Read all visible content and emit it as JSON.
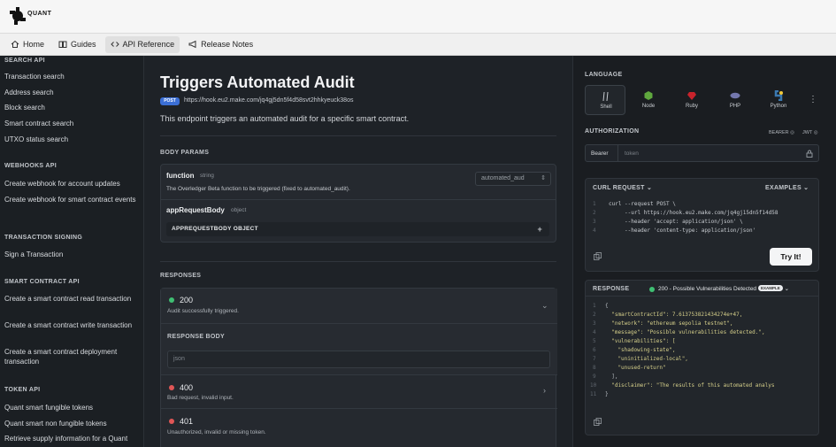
{
  "brand": {
    "name": "QUANT"
  },
  "nav": {
    "tabs": [
      {
        "label": "Home",
        "icon": "home-icon"
      },
      {
        "label": "Guides",
        "icon": "book-icon"
      },
      {
        "label": "API Reference",
        "icon": "code-icon",
        "active": true
      },
      {
        "label": "Release Notes",
        "icon": "megaphone-icon"
      }
    ]
  },
  "sidebar": {
    "search_head": "SEARCH API",
    "search_items": [
      "Transaction search",
      "Address search",
      "Block search",
      "Smart contract search",
      "UTXO status search"
    ],
    "webhooks_head": "WEBHOOKS API",
    "webhooks_items": [
      "Create webhook for account updates",
      "Create webhook for smart contract events"
    ],
    "signing_head": "TRANSACTION SIGNING",
    "signing_items": [
      "Sign a Transaction"
    ],
    "contract_head": "SMART CONTRACT API",
    "contract_items": [
      "Create a smart contract read transaction",
      "Create a smart contract write transaction",
      "Create a smart contract deployment transaction"
    ],
    "token_head": "TOKEN API",
    "token_items": [
      "Quant smart fungible tokens",
      "Quant smart non fungible tokens",
      "Retrieve supply information for a Quant"
    ]
  },
  "main": {
    "title": "Triggers Automated Audit",
    "method": "POST",
    "url": "https://hook.eu2.make.com/jq4gj5dn5f4d58svt2hhkyeuck38os",
    "description": "This endpoint triggers an automated audit for a specific smart contract.",
    "body_params_label": "BODY PARAMS",
    "param1": {
      "name": "function",
      "type": "string",
      "description": "The Overledger Beta function to be triggered (fixed to automated_audit).",
      "value": "automated_aud"
    },
    "param2": {
      "name": "appRequestBody",
      "type": "object",
      "button": "APPREQUESTBODY OBJECT"
    },
    "responses_label": "RESPONSES",
    "responses": [
      {
        "code": "200",
        "desc": "Audit successfully triggered.",
        "color": "#3fbf73"
      },
      {
        "code": "400",
        "desc": "Bad request, invalid input.",
        "color": "#e05656"
      },
      {
        "code": "401",
        "desc": "Unauthorized, invalid or missing token.",
        "color": "#e05656"
      }
    ],
    "response_body_label": "RESPONSE BODY",
    "response_body_placeholder": "json"
  },
  "right": {
    "language_label": "LANGUAGE",
    "languages": [
      {
        "name": "Shell",
        "color": "#6b7178",
        "active": true
      },
      {
        "name": "Node",
        "color": "#5fa83e"
      },
      {
        "name": "Ruby",
        "color": "#c8232c"
      },
      {
        "name": "PHP",
        "color": "#7377ad"
      },
      {
        "name": "Python",
        "color": "#3b79b0"
      }
    ],
    "authorization_label": "AUTHORIZATION",
    "auth_options": [
      "BEARER",
      "JWT"
    ],
    "auth_prefix": "Bearer",
    "auth_placeholder": "token",
    "curl_label": "CURL REQUEST",
    "examples_label": "EXAMPLES",
    "curl_lines": [
      "curl --request POST \\",
      "     --url https://hook.eu2.make.com/jq4gj15dn5f14d58",
      "     --header 'accept: application/json' \\",
      "     --header 'content-type: application/json'"
    ],
    "try_label": "Try It!",
    "response_label": "RESPONSE",
    "response_status": "200 - Possible Vulnerabilities Detected",
    "response_badge": "EXAMPLE",
    "response_lines": [
      "{",
      "  \"smartContractId\": 7.613753821434274e+47,",
      "  \"network\": \"ethereum sepolia testnet\",",
      "  \"message\": \"Possible vulnerabilities detected.\",",
      "  \"vulnerabilities\": [",
      "    \"shadowing-state\",",
      "    \"uninitialized-local\",",
      "    \"unused-return\"",
      "  ],",
      "  \"disclaimer\": \"The results of this automated analys",
      "}"
    ]
  }
}
